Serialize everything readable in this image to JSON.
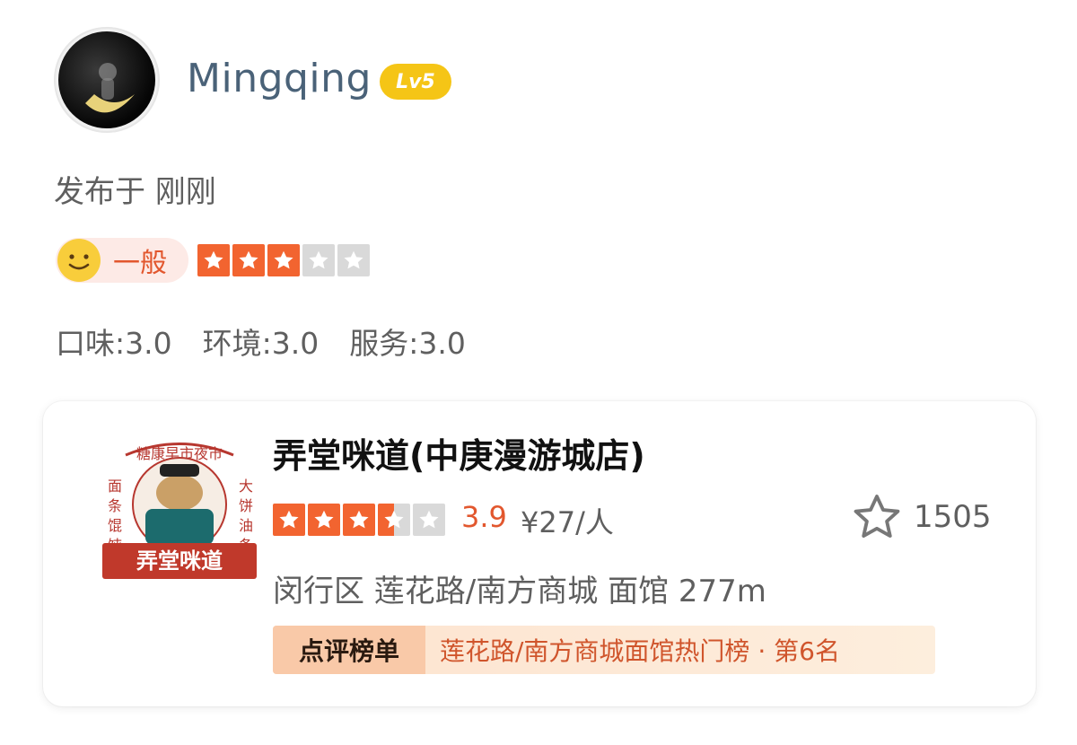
{
  "user": {
    "name": "Mingqing",
    "level": "Lv5",
    "posted": "发布于 刚刚"
  },
  "review": {
    "sentiment": "一般",
    "stars": 3,
    "stars_max": 5,
    "sub_ratings": [
      {
        "label": "口味:3.0"
      },
      {
        "label": "环境:3.0"
      },
      {
        "label": "服务:3.0"
      }
    ]
  },
  "shop": {
    "name": "弄堂咪道(中庚漫游城店)",
    "logo_text": "弄堂咪道",
    "rating_stars": 3.5,
    "score": "3.9",
    "price": "¥27/人",
    "favorites": "1505",
    "location": "闵行区 莲花路/南方商城 面馆   277m",
    "ranking_tag": "点评榜单",
    "ranking_text": "莲花路/南方商城面馆热门榜 · 第6名"
  },
  "colors": {
    "accent": "#f26430",
    "badge": "#f5c516",
    "username": "#4a6278"
  }
}
